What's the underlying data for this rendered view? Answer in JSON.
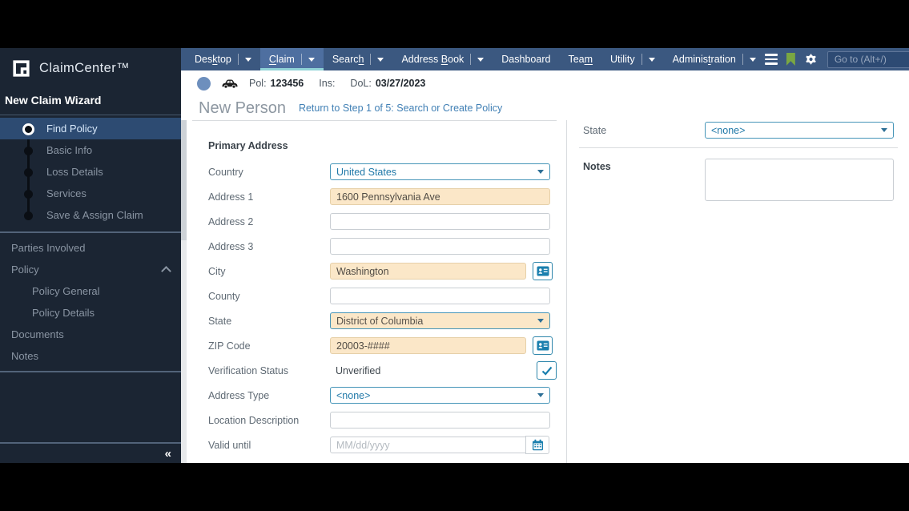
{
  "brand": {
    "logo_text": "ClaimCenter™"
  },
  "nav": {
    "items": [
      {
        "label": "Desktop",
        "key_index": 3,
        "caret": true,
        "active": false
      },
      {
        "label": "Claim",
        "key_index": 0,
        "caret": true,
        "active": true
      },
      {
        "label": "Search",
        "key_index": 5,
        "caret": true,
        "active": false
      },
      {
        "label": "Address Book",
        "key_index": 8,
        "caret": true,
        "active": false
      },
      {
        "label": "Dashboard",
        "key_index": -1,
        "caret": false,
        "active": false
      },
      {
        "label": "Team",
        "key_index": 3,
        "caret": false,
        "active": false
      },
      {
        "label": "Utility",
        "key_index": -1,
        "caret": true,
        "active": false
      },
      {
        "label": "Administration",
        "key_index": 7,
        "caret": true,
        "active": false
      }
    ],
    "goto_placeholder": "Go to (Alt+/)"
  },
  "claim_bar": {
    "pol_label": "Pol:",
    "pol_value": "123456",
    "ins_label": "Ins:",
    "dol_label": "DoL:",
    "dol_value": "03/27/2023"
  },
  "sidebar": {
    "wizard_title": "New Claim Wizard",
    "steps": [
      {
        "label": "Find Policy",
        "active": true
      },
      {
        "label": "Basic Info",
        "active": false
      },
      {
        "label": "Loss Details",
        "active": false
      },
      {
        "label": "Services",
        "active": false
      },
      {
        "label": "Save & Assign Claim",
        "active": false
      }
    ],
    "menu": [
      {
        "label": "Parties Involved",
        "indent": 0,
        "expander": null
      },
      {
        "label": "Policy",
        "indent": 0,
        "expander": "up"
      },
      {
        "label": "Policy General",
        "indent": 1,
        "expander": null
      },
      {
        "label": "Policy Details",
        "indent": 1,
        "expander": null
      },
      {
        "label": "Documents",
        "indent": 0,
        "expander": null
      },
      {
        "label": "Notes",
        "indent": 0,
        "expander": null
      }
    ],
    "collapse_label": "«"
  },
  "page": {
    "title": "New Person",
    "return_link": "Return to Step 1 of 5: Search or Create Policy",
    "section": "Primary Address",
    "fields": [
      {
        "label": "Country",
        "type": "select",
        "value": "United States",
        "filled": false,
        "button": null
      },
      {
        "label": "Address 1",
        "type": "input",
        "value": "1600 Pennsylvania Ave",
        "filled": true,
        "button": null
      },
      {
        "label": "Address 2",
        "type": "input",
        "value": "",
        "filled": false,
        "button": null
      },
      {
        "label": "Address 3",
        "type": "input",
        "value": "",
        "filled": false,
        "button": null
      },
      {
        "label": "City",
        "type": "input",
        "value": "Washington",
        "filled": true,
        "button": "contact-card"
      },
      {
        "label": "County",
        "type": "input",
        "value": "",
        "filled": false,
        "button": null
      },
      {
        "label": "State",
        "type": "select",
        "value": "District of Columbia",
        "filled": true,
        "button": null
      },
      {
        "label": "ZIP Code",
        "type": "input",
        "value": "20003-####",
        "filled": true,
        "button": "contact-card"
      },
      {
        "label": "Verification Status",
        "type": "text",
        "value": "Unverified",
        "filled": false,
        "button": "check"
      },
      {
        "label": "Address Type",
        "type": "select",
        "value": "<none>",
        "filled": false,
        "button": null
      },
      {
        "label": "Location Description",
        "type": "input",
        "value": "",
        "filled": false,
        "button": null
      },
      {
        "label": "Valid until",
        "type": "date",
        "value": "",
        "placeholder": "MM/dd/yyyy",
        "filled": false,
        "button": "calendar"
      }
    ],
    "right_panel": {
      "state_label": "State",
      "state_value": "<none>",
      "notes_label": "Notes",
      "notes_value": ""
    }
  },
  "colors": {
    "nav_bar": "#3b5880",
    "active_tab": "#4e6fa0",
    "active_tab_underline": "#8fd2d6",
    "sidebar_bg": "#1b2533",
    "selected_step": "#2d4b72",
    "filled_field": "#fbe7c8",
    "accent_teal": "#2e86ab",
    "bookmark_green": "#7aa742",
    "link_blue": "#4180b5"
  }
}
